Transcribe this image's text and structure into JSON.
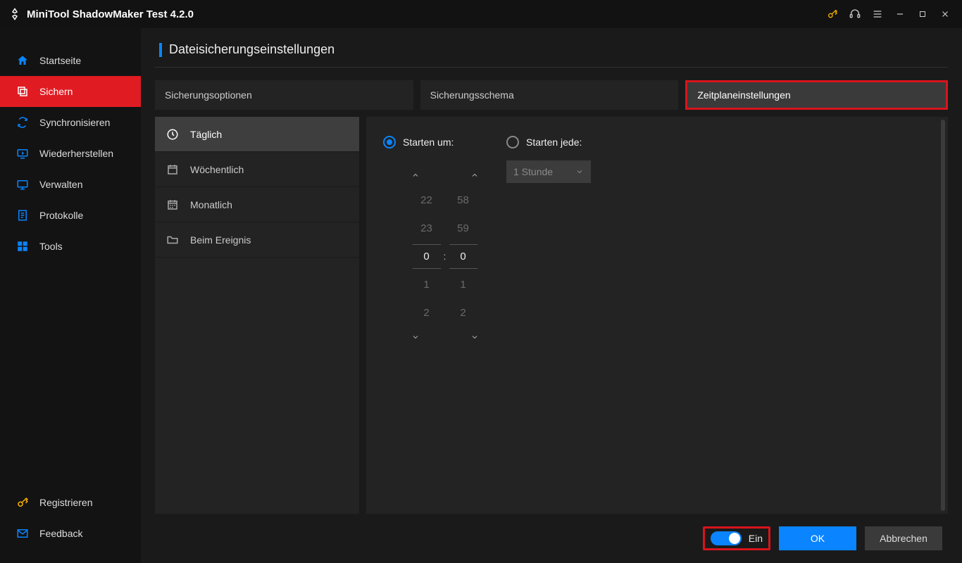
{
  "title": "MiniTool ShadowMaker Test 4.2.0",
  "sidebar": {
    "items": [
      {
        "label": "Startseite"
      },
      {
        "label": "Sichern"
      },
      {
        "label": "Synchronisieren"
      },
      {
        "label": "Wiederherstellen"
      },
      {
        "label": "Verwalten"
      },
      {
        "label": "Protokolle"
      },
      {
        "label": "Tools"
      }
    ],
    "footer": [
      {
        "label": "Registrieren"
      },
      {
        "label": "Feedback"
      }
    ]
  },
  "page": {
    "title": "Dateisicherungseinstellungen"
  },
  "tabs": [
    {
      "label": "Sicherungsoptionen"
    },
    {
      "label": "Sicherungsschema"
    },
    {
      "label": "Zeitplaneinstellungen"
    }
  ],
  "schedule": {
    "modes": [
      {
        "label": "Täglich"
      },
      {
        "label": "Wöchentlich"
      },
      {
        "label": "Monatlich"
      },
      {
        "label": "Beim Ereignis"
      }
    ],
    "start_at_label": "Starten um:",
    "start_every_label": "Starten jede:",
    "interval_value": "1 Stunde",
    "hours": {
      "m2": "22",
      "m1": "23",
      "cur": "0",
      "p1": "1",
      "p2": "2"
    },
    "minutes": {
      "m2": "58",
      "m1": "59",
      "cur": "0",
      "p1": "1",
      "p2": "2"
    }
  },
  "footer": {
    "toggle_label": "Ein",
    "ok": "OK",
    "cancel": "Abbrechen"
  }
}
